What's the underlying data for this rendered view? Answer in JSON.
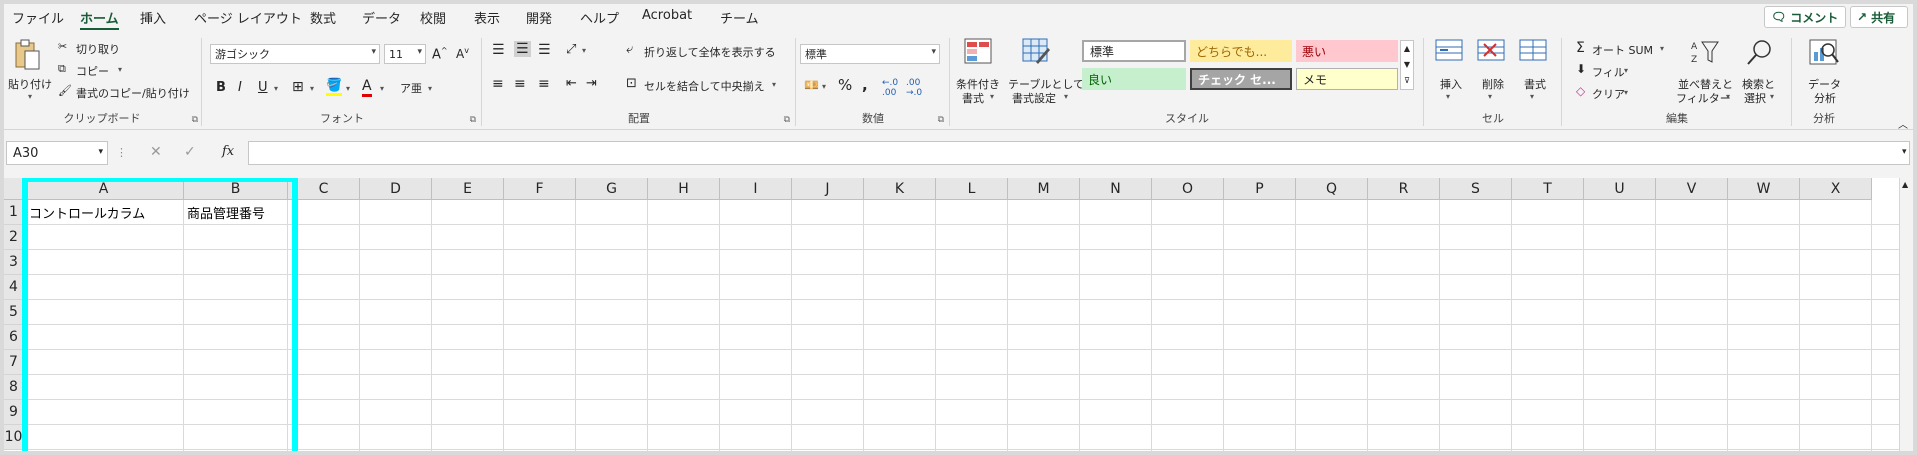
{
  "menu": {
    "tabs": [
      "ファイル",
      "ホーム",
      "挿入",
      "ページ レイアウト",
      "数式",
      "データ",
      "校閲",
      "表示",
      "開発",
      "ヘルプ",
      "Acrobat",
      "チーム"
    ],
    "active_tab": "ホーム",
    "comment_button": "コメント",
    "share_button": "共有"
  },
  "ribbon": {
    "clipboard": {
      "paste": "貼り付け",
      "cut": "切り取り",
      "copy": "コピー",
      "format_painter": "書式のコピー/貼り付け",
      "group_label": "クリップボード"
    },
    "font": {
      "font_name": "游ゴシック",
      "font_size": "11",
      "group_label": "フォント"
    },
    "alignment": {
      "wrap_text": "折り返して全体を表示する",
      "merge_center": "セルを結合して中央揃え",
      "group_label": "配置"
    },
    "number": {
      "format": "標準",
      "group_label": "数値"
    },
    "styles": {
      "conditional_line1": "条件付き",
      "conditional_line2": "書式",
      "table_line1": "テーブルとして",
      "table_line2": "書式設定",
      "style_normal": "標準",
      "style_neutral": "どちらでも...",
      "style_bad": "悪い",
      "style_good": "良い",
      "style_check": "チェック セ...",
      "style_memo": "メモ",
      "group_label": "スタイル"
    },
    "cells": {
      "insert": "挿入",
      "delete": "削除",
      "format": "書式",
      "group_label": "セル"
    },
    "editing": {
      "autosum": "オート SUM",
      "fill": "フィル",
      "clear": "クリア",
      "sort_line1": "並べ替えと",
      "sort_line2": "フィルター",
      "find_line1": "検索と",
      "find_line2": "選択",
      "group_label": "編集"
    },
    "analysis": {
      "data_line1": "データ",
      "data_line2": "分析",
      "group_label": "分析"
    }
  },
  "formula_bar": {
    "name_box": "A30",
    "formula": ""
  },
  "sheet": {
    "columns": [
      "A",
      "B",
      "C",
      "D",
      "E",
      "F",
      "G",
      "H",
      "I",
      "J",
      "K",
      "L",
      "M",
      "N",
      "O",
      "P",
      "Q",
      "R",
      "S",
      "T",
      "U",
      "V",
      "W",
      "X"
    ],
    "rows": [
      "1",
      "2",
      "3",
      "4",
      "5",
      "6",
      "7",
      "8",
      "9",
      "10"
    ],
    "cells": {
      "A1": "コントロールカラム",
      "B1": "商品管理番号"
    },
    "highlight_color": "#00ffff"
  }
}
